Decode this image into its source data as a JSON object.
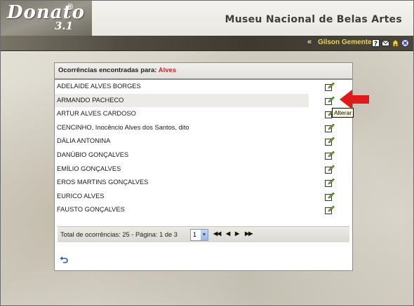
{
  "header": {
    "logo_text": "Donato",
    "logo_version": "3.1",
    "logo_reg": "®",
    "museum_title": "Museu Nacional de Belas Artes"
  },
  "userbar": {
    "chevron": "«",
    "username": "Gilson Gemente",
    "icons": [
      "help-icon",
      "mail-icon",
      "home-icon",
      "close-icon"
    ]
  },
  "results": {
    "header_label": "Ocorrências encontradas para:",
    "search_term": "Alves",
    "rows": [
      {
        "name": "ADELAIDE ALVES BORGES"
      },
      {
        "name": "ARMANDO PACHECO"
      },
      {
        "name": "ARTUR ALVES CARDOSO"
      },
      {
        "name": "CENCINHO, Inocêncio Alves dos Santos, dito"
      },
      {
        "name": "DÁLIA ANTONINA"
      },
      {
        "name": "DANÚBIO GONÇALVES"
      },
      {
        "name": "EMÍLIO GONÇALVES"
      },
      {
        "name": "EROS MARTINS GONÇALVES"
      },
      {
        "name": "EURICO ALVES"
      },
      {
        "name": "FAUSTO GONÇALVES"
      }
    ],
    "highlighted_row": 1
  },
  "tooltip": "Alterar",
  "pagination": {
    "summary": "Total de ocorrências: 25 - Página: 1 de 3",
    "page_value": "1",
    "first": "◀◀",
    "prev": "◀",
    "next": "▶",
    "last": "▶▶"
  },
  "colors": {
    "search_term": "#c62828",
    "username": "#e8d35a",
    "annotation_arrow": "#e0191b"
  }
}
